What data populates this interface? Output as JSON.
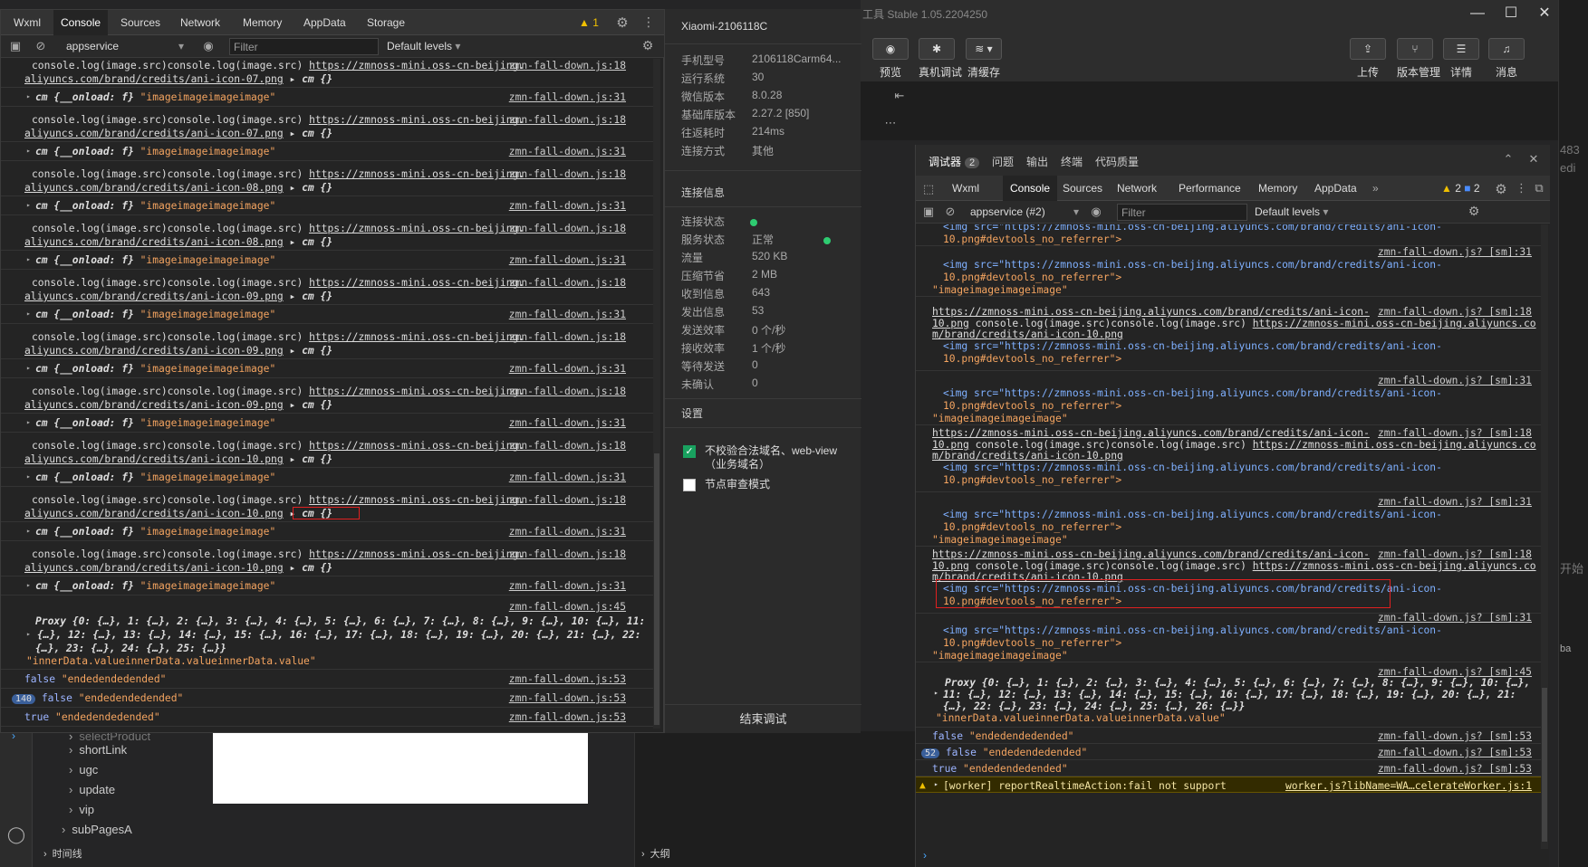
{
  "ide": {
    "title": "工具 Stable 1.05.2204250",
    "toolbar": [
      {
        "label": "预览",
        "icon": "eye-icon",
        "glyph": "◉"
      },
      {
        "label": "真机调试",
        "icon": "bug-icon",
        "glyph": "✱"
      },
      {
        "label": "清缓存",
        "icon": "layers-icon",
        "glyph": "≋ ▾"
      },
      {
        "label": "上传",
        "icon": "upload-icon",
        "glyph": "⇪"
      },
      {
        "label": "版本管理",
        "icon": "branch-icon",
        "glyph": "⑂"
      },
      {
        "label": "详情",
        "icon": "menu-icon",
        "glyph": "☰"
      },
      {
        "label": "消息",
        "icon": "bell-icon",
        "glyph": "♫"
      }
    ],
    "window": {
      "minimize": "—",
      "maximize": "☐",
      "close": "✕"
    },
    "edge_text": [
      "483",
      "edi",
      "开始",
      "ba"
    ],
    "tree": [
      "selectProduct",
      "shortLink",
      "ugc",
      "update",
      "vip",
      "subPagesA"
    ],
    "timeline": "时间线",
    "outline": "大纲"
  },
  "left_devtools": {
    "tabs": [
      "Wxml",
      "Console",
      "Sources",
      "Network",
      "Memory",
      "AppData",
      "Storage"
    ],
    "active_tab": "Console",
    "warn_count": "1",
    "context": "appservice",
    "filter_placeholder": "Filter",
    "levels": "Default levels",
    "logs": [
      {
        "kind": "img",
        "pre": "console.log(image.src)console.log(image.src) ",
        "url1": "https://zmnoss-mini.oss-cn-beijing.",
        "url2": "aliyuncs.com/brand/credits/ani-icon-07.png",
        "obj": "cm {}",
        "src": "zmn-fall-down.js:18"
      },
      {
        "kind": "onload",
        "obj": "cm {__onload: f}",
        "str": "\"imageimageimageimage\"",
        "src": "zmn-fall-down.js:31"
      },
      {
        "kind": "img",
        "pre": "console.log(image.src)console.log(image.src) ",
        "url1": "https://zmnoss-mini.oss-cn-beijing.",
        "url2": "aliyuncs.com/brand/credits/ani-icon-07.png",
        "obj": "cm {}",
        "src": "zmn-fall-down.js:18"
      },
      {
        "kind": "onload",
        "obj": "cm {__onload: f}",
        "str": "\"imageimageimageimage\"",
        "src": "zmn-fall-down.js:31"
      },
      {
        "kind": "img",
        "pre": "console.log(image.src)console.log(image.src) ",
        "url1": "https://zmnoss-mini.oss-cn-beijing.",
        "url2": "aliyuncs.com/brand/credits/ani-icon-08.png",
        "obj": "cm {}",
        "src": "zmn-fall-down.js:18"
      },
      {
        "kind": "onload",
        "obj": "cm {__onload: f}",
        "str": "\"imageimageimageimage\"",
        "src": "zmn-fall-down.js:31"
      },
      {
        "kind": "img",
        "pre": "console.log(image.src)console.log(image.src) ",
        "url1": "https://zmnoss-mini.oss-cn-beijing.",
        "url2": "aliyuncs.com/brand/credits/ani-icon-08.png",
        "obj": "cm {}",
        "src": "zmn-fall-down.js:18"
      },
      {
        "kind": "onload",
        "obj": "cm {__onload: f}",
        "str": "\"imageimageimageimage\"",
        "src": "zmn-fall-down.js:31"
      },
      {
        "kind": "img",
        "pre": "console.log(image.src)console.log(image.src) ",
        "url1": "https://zmnoss-mini.oss-cn-beijing.",
        "url2": "aliyuncs.com/brand/credits/ani-icon-09.png",
        "obj": "cm {}",
        "src": "zmn-fall-down.js:18"
      },
      {
        "kind": "onload",
        "obj": "cm {__onload: f}",
        "str": "\"imageimageimageimage\"",
        "src": "zmn-fall-down.js:31"
      },
      {
        "kind": "img",
        "pre": "console.log(image.src)console.log(image.src) ",
        "url1": "https://zmnoss-mini.oss-cn-beijing.",
        "url2": "aliyuncs.com/brand/credits/ani-icon-09.png",
        "obj": "cm {}",
        "src": "zmn-fall-down.js:18"
      },
      {
        "kind": "onload",
        "obj": "cm {__onload: f}",
        "str": "\"imageimageimageimage\"",
        "src": "zmn-fall-down.js:31"
      },
      {
        "kind": "img",
        "pre": "console.log(image.src)console.log(image.src) ",
        "url1": "https://zmnoss-mini.oss-cn-beijing.",
        "url2": "aliyuncs.com/brand/credits/ani-icon-09.png",
        "obj": "cm {}",
        "src": "zmn-fall-down.js:18"
      },
      {
        "kind": "onload",
        "obj": "cm {__onload: f}",
        "str": "\"imageimageimageimage\"",
        "src": "zmn-fall-down.js:31"
      },
      {
        "kind": "img",
        "pre": "console.log(image.src)console.log(image.src) ",
        "url1": "https://zmnoss-mini.oss-cn-beijing.",
        "url2": "aliyuncs.com/brand/credits/ani-icon-10.png",
        "obj": "cm {}",
        "src": "zmn-fall-down.js:18"
      },
      {
        "kind": "onload",
        "obj": "cm {__onload: f}",
        "str": "\"imageimageimageimage\"",
        "src": "zmn-fall-down.js:31"
      },
      {
        "kind": "img",
        "pre": "console.log(image.src)console.log(image.src) ",
        "url1": "https://zmnoss-mini.oss-cn-beijing.",
        "url2": "aliyuncs.com/brand/credits/ani-icon-10.png",
        "obj": "cm {}",
        "src": "zmn-fall-down.js:18",
        "highlight": true
      },
      {
        "kind": "onload",
        "obj": "cm {__onload: f}",
        "str": "\"imageimageimageimage\"",
        "src": "zmn-fall-down.js:31"
      },
      {
        "kind": "img",
        "pre": "console.log(image.src)console.log(image.src) ",
        "url1": "https://zmnoss-mini.oss-cn-beijing.",
        "url2": "aliyuncs.com/brand/credits/ani-icon-10.png",
        "obj": "cm {}",
        "src": "zmn-fall-down.js:18"
      },
      {
        "kind": "onload",
        "obj": "cm {__onload: f}",
        "str": "\"imageimageimageimage\"",
        "src": "zmn-fall-down.js:31"
      }
    ],
    "proxy": {
      "src": "zmn-fall-down.js:45",
      "line1": "Proxy {0: {…}, 1: {…}, 2: {…}, 3: {…}, 4: {…}, 5: {…}, 6: {…}, 7: {…}, 8: {…}, 9: {…}, 10: {…}, 11:",
      "line2": "{…}, 12: {…}, 13: {…}, 14: {…}, 15: {…}, 16: {…}, 17: {…}, 18: {…}, 19: {…}, 20: {…}, 21: {…}, 22:",
      "line3": "{…}, 23: {…}, 24: {…}, 25: {…}}",
      "line4": "\"innerData.valueinnerData.valueinnerData.value\""
    },
    "ended": [
      {
        "count": "",
        "bool": "false",
        "str": "\"endedendedended\"",
        "src": "zmn-fall-down.js:53"
      },
      {
        "count": "140",
        "bool": "false",
        "str": "\"endedendedended\"",
        "src": "zmn-fall-down.js:53"
      },
      {
        "count": "",
        "bool": "true",
        "str": "\"endedendedended\"",
        "src": "zmn-fall-down.js:53"
      }
    ],
    "prompt": "›"
  },
  "info": {
    "device": "Xiaomi-2106118C",
    "rows": [
      {
        "k": "手机型号",
        "v": "2106118Carm64..."
      },
      {
        "k": "运行系统",
        "v": "30"
      },
      {
        "k": "微信版本",
        "v": "8.0.28"
      },
      {
        "k": "基础库版本",
        "v": "2.27.2 [850]"
      },
      {
        "k": "往返耗时",
        "v": "214ms"
      },
      {
        "k": "连接方式",
        "v": "其他"
      }
    ],
    "conn_title": "连接信息",
    "conn": [
      {
        "k": "连接状态",
        "v": ""
      },
      {
        "k": "服务状态",
        "v": "正常"
      },
      {
        "k": "流量",
        "v": "520 KB"
      },
      {
        "k": "压缩节省",
        "v": "2 MB"
      },
      {
        "k": "收到信息",
        "v": "643"
      },
      {
        "k": "发出信息",
        "v": "53"
      },
      {
        "k": "发送效率",
        "v": "0 个/秒"
      },
      {
        "k": "接收效率",
        "v": "1 个/秒"
      },
      {
        "k": "等待发送",
        "v": "0"
      },
      {
        "k": "未确认",
        "v": "0"
      }
    ],
    "settings_title": "设置",
    "opt1": "不校验合法域名、web-view（业务域名）",
    "opt2": "节点审查模式",
    "end_btn": "结束调试",
    "status_color": "#2ecc71"
  },
  "right_devtools": {
    "top_tabs": [
      "调试器",
      "问题",
      "输出",
      "终端",
      "代码质量"
    ],
    "debugger_count": "2",
    "tabs": [
      "Wxml",
      "Console",
      "Sources",
      "Network",
      "Performance",
      "Memory",
      "AppData"
    ],
    "active_tab": "Console",
    "warn": "2",
    "info": "2",
    "context": "appservice (#2)",
    "filter_placeholder": "Filter",
    "levels": "Default levels",
    "tag_open": "<img src=\"https://zmnoss-mini.oss-cn-beijing.aliyuncs.com/brand/credits/ani-icon-",
    "tag_close": "10.png#devtools_no_referrer\">",
    "img_str": "\"imageimageimageimage\"",
    "src31": "zmn-fall-down.js? [sm]:31",
    "src18": "zmn-fall-down.js? [sm]:18",
    "src45": "zmn-fall-down.js? [sm]:45",
    "src53": "zmn-fall-down.js? [sm]:53",
    "url_a": "https://zmnoss-mini.oss-cn-beijing.aliyuncs.com/brand/credits/ani-icon-",
    "url_b1": "10.png",
    "url_b2": " console.log(image.src)console.log(image.src) ",
    "url_b3": "https://zmnoss-mini.oss-cn-beijing.aliyuncs.co",
    "url_c": "m/brand/credits/ani-icon-10.png",
    "proxy1": "Proxy {0: {…}, 1: {…}, 2: {…}, 3: {…}, 4: {…}, 5: {…}, 6: {…}, 7: {…}, 8: {…}, 9: {…}, 10: {…},",
    "proxy2": "11: {…}, 12: {…}, 13: {…}, 14: {…}, 15: {…}, 16: {…}, 17: {…}, 18: {…}, 19: {…}, 20: {…}, 21:",
    "proxy3": "{…}, 22: {…}, 23: {…}, 24: {…}, 25: {…}, 26: {…}}",
    "proxy4": "\"innerData.valueinnerData.valueinnerData.value\"",
    "ended": [
      {
        "count": "",
        "bool": "false",
        "str": "\"endedendedended\""
      },
      {
        "count": "52",
        "bool": "false",
        "str": "\"endedendedended\""
      },
      {
        "count": "",
        "bool": "true",
        "str": "\"endedendedended\""
      }
    ],
    "warning": "[worker] reportRealtimeAction:fail not support",
    "warning_src": "worker.js?libName=WA…celerateWorker.js:1",
    "prompt": "›"
  }
}
